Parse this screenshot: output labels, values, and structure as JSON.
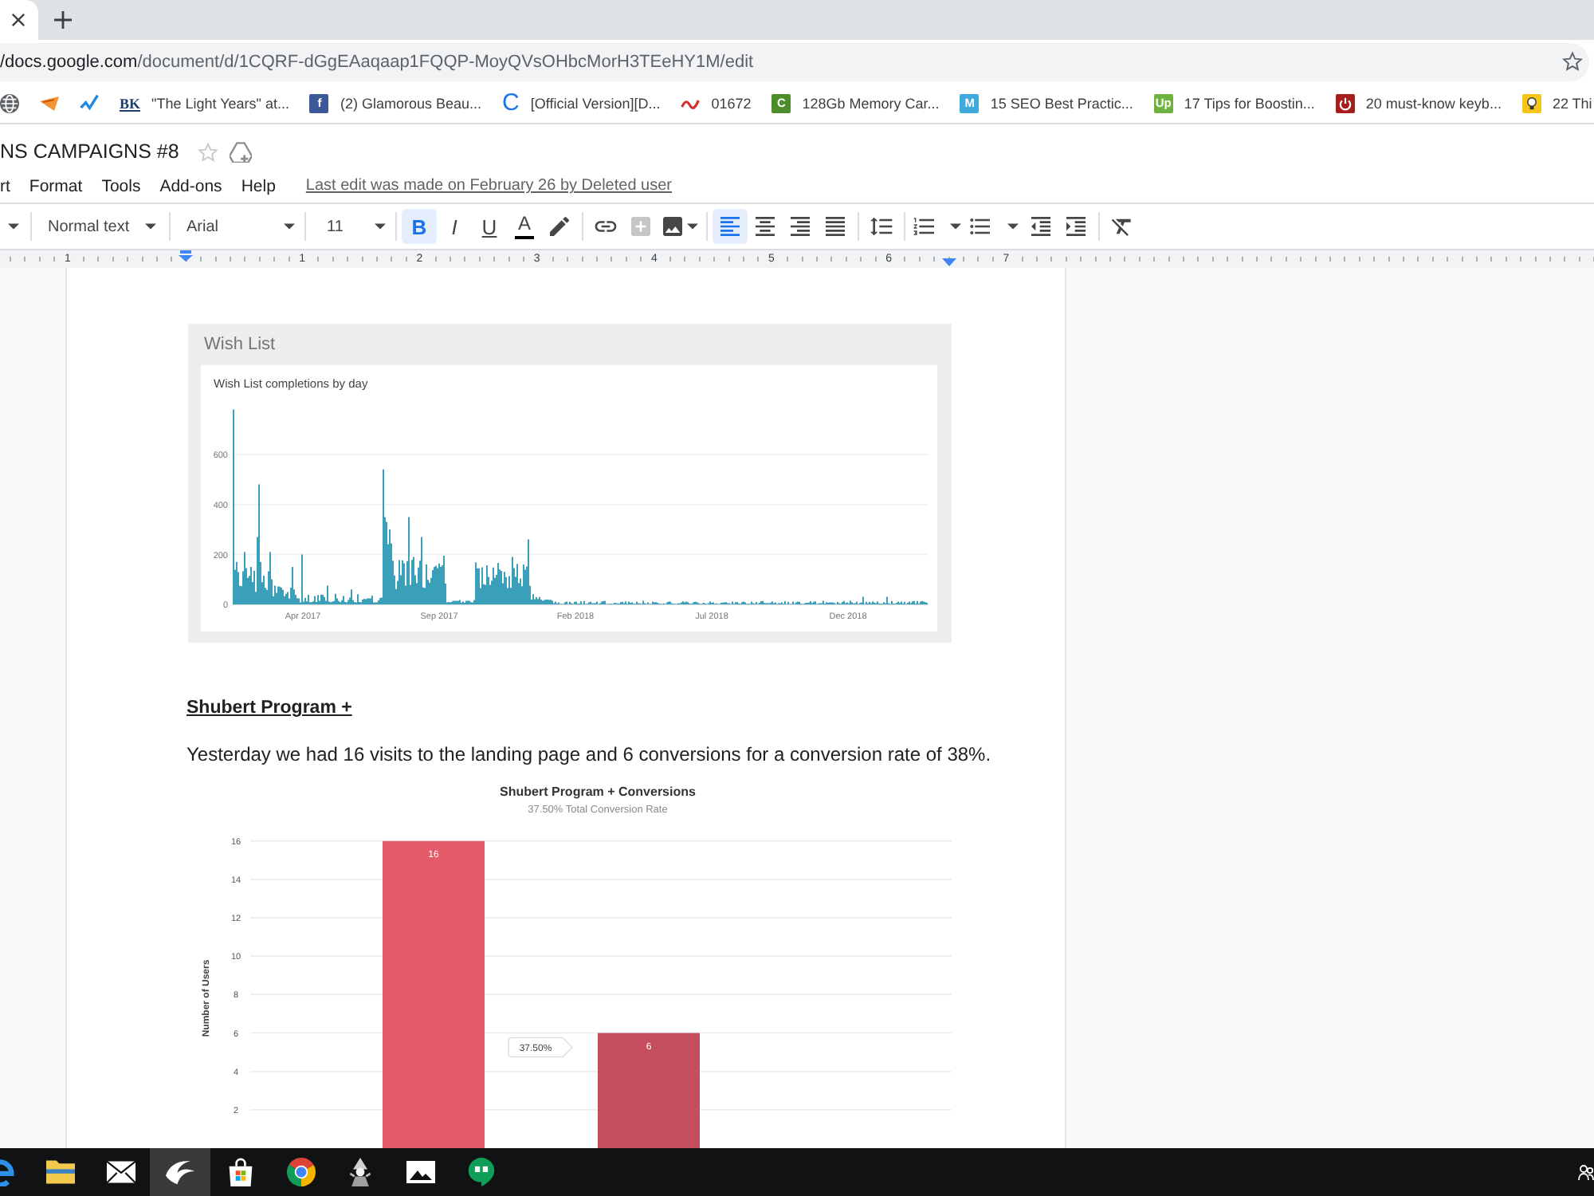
{
  "browser": {
    "url_host": "/docs.google.com",
    "url_path": "/document/d/1CQRF-dGgEAaqaap1FQQP-MoyQVsOHbcMorH3TEeHY1M/edit",
    "bookmarked": false
  },
  "bookmarks": [
    {
      "kind": "globe"
    },
    {
      "kind": "wedge"
    },
    {
      "kind": "swoosh"
    },
    {
      "kind": "serif-logo",
      "logo": "BK",
      "label": "\"The Light Years\" at..."
    },
    {
      "kind": "square-logo",
      "logo": "f",
      "color": "#3b5998",
      "label": "(2) Glamorous Beau..."
    },
    {
      "kind": "letter-logo",
      "logo": "C",
      "label": "[Official Version][D..."
    },
    {
      "kind": "squiggle",
      "label": "01672"
    },
    {
      "kind": "square-logo",
      "logo": "C",
      "color": "#4c8c2b",
      "label": "128Gb Memory Car..."
    },
    {
      "kind": "square-logo",
      "logo": "M",
      "color": "#3fa9dc",
      "label": "15 SEO Best Practic..."
    },
    {
      "kind": "square-logo",
      "logo": "Up",
      "color": "#6fb23f",
      "label": "17 Tips for Boostin..."
    },
    {
      "kind": "power",
      "label": "20 must-know keyb..."
    },
    {
      "kind": "bulb",
      "label": "22 Thi"
    }
  ],
  "doc": {
    "title": "NS CAMPAIGNS #8",
    "starred": false,
    "menu": [
      "rt",
      "Format",
      "Tools",
      "Add-ons",
      "Help"
    ],
    "last_edit": "Last edit was made on February 26 by Deleted user"
  },
  "toolbar": [
    {
      "kind": "menu-caret"
    },
    {
      "kind": "separator"
    },
    {
      "kind": "dropdown",
      "label": "Normal text"
    },
    {
      "kind": "separator"
    },
    {
      "kind": "dropdown",
      "label": "Arial"
    },
    {
      "kind": "separator"
    },
    {
      "kind": "dropdown",
      "label": "11"
    },
    {
      "kind": "separator"
    },
    {
      "kind": "bold",
      "label": "B",
      "on": true,
      "disabled": false
    },
    {
      "kind": "italic",
      "label": "I",
      "on": false,
      "disabled": false
    },
    {
      "kind": "underline",
      "label": "U",
      "on": false,
      "disabled": false
    },
    {
      "kind": "text-color",
      "label": "A",
      "on": false,
      "disabled": false
    },
    {
      "kind": "highlight",
      "on": false,
      "disabled": false
    },
    {
      "kind": "separator"
    },
    {
      "kind": "link",
      "on": false,
      "disabled": false
    },
    {
      "kind": "comment",
      "on": false,
      "disabled": true
    },
    {
      "kind": "image",
      "on": false,
      "disabled": false
    },
    {
      "kind": "separator"
    },
    {
      "kind": "align-left",
      "on": true,
      "disabled": false
    },
    {
      "kind": "align-center",
      "on": false,
      "disabled": false
    },
    {
      "kind": "align-right",
      "on": false,
      "disabled": false
    },
    {
      "kind": "justify",
      "on": false,
      "disabled": false
    },
    {
      "kind": "separator"
    },
    {
      "kind": "line-spacing",
      "on": false,
      "disabled": false
    },
    {
      "kind": "separator"
    },
    {
      "kind": "numbered-list",
      "on": false,
      "disabled": false
    },
    {
      "kind": "bulleted-list",
      "on": false,
      "disabled": false
    },
    {
      "kind": "indent-decrease",
      "on": false,
      "disabled": false
    },
    {
      "kind": "indent-increase",
      "on": false,
      "disabled": false
    },
    {
      "kind": "separator"
    },
    {
      "kind": "clear-format",
      "on": false,
      "disabled": false
    }
  ],
  "ruler": {
    "labels": [
      "1",
      "1",
      "2",
      "3",
      "4",
      "5",
      "6",
      "7"
    ]
  },
  "wish_list": {
    "title": "Wish List",
    "chart_title": "Wish List completions by day",
    "y_ticks": [
      "600",
      "400",
      "200",
      "0"
    ],
    "x_ticks": [
      "Apr 2017",
      "Sep 2017",
      "Feb 2018",
      "Jul 2018",
      "Dec 2018"
    ]
  },
  "section": {
    "heading": "Shubert Program +",
    "paragraph": "Yesterday we had 16 visits to the landing page and 6 conversions for a conversion rate of 38%.",
    "chart_data": {
      "type": "bar",
      "title": "Shubert Program + Conversions",
      "subtitle": "37.50% Total Conversion Rate",
      "ylabel": "Number of Users",
      "categories": [
        null,
        null
      ],
      "values": [
        16,
        6
      ],
      "colors": [
        "#e35b6b",
        "#c44d5e"
      ],
      "ylim": [
        0,
        16
      ],
      "yticks": [
        2,
        4,
        6,
        8,
        10,
        12,
        14,
        16
      ],
      "data_labels": true,
      "grid": true,
      "annotations": [
        "37.50%"
      ]
    }
  },
  "taskbar": [
    {
      "kind": "e-logo",
      "selected": false
    },
    {
      "kind": "folder",
      "selected": false
    },
    {
      "kind": "mail",
      "selected": false
    },
    {
      "kind": "swoosh",
      "selected": true
    },
    {
      "kind": "bag",
      "selected": false
    },
    {
      "kind": "round-logo",
      "selected": false
    },
    {
      "kind": "figure",
      "selected": false
    },
    {
      "kind": "photo",
      "selected": false
    },
    {
      "kind": "chat",
      "selected": false
    }
  ]
}
